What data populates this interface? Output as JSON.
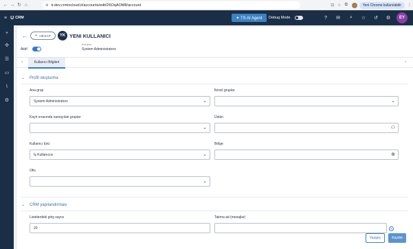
{
  "browser": {
    "url": "tr.dev.crmincloud.it/accounts/edit/26OqAOM8/account",
    "profile_label": "Yeni Chrome kullanılabilir"
  },
  "header": {
    "brand": "CRM",
    "brand_mark": "U",
    "agent_button": "✦ TS AI Agent",
    "debug_label": "Debug Mode",
    "user_initials": "EY"
  },
  "page": {
    "entity_button": "HESAP",
    "avatar_initials": "YK",
    "title": "YENI KULLANICI",
    "active_label": "Aktif",
    "ana_grup_small": "Ana grup",
    "ana_grup_value": "System Administrators"
  },
  "tabs": [
    {
      "label": "Kullanıcı Bilgileri"
    }
  ],
  "sections": {
    "profile": {
      "title": "Profil oluşturma",
      "fields": {
        "ana_grup": {
          "label": "Ana grup",
          "value": "System Administrators"
        },
        "ikincil_gruplar": {
          "label": "İkincil gruplar",
          "value": ""
        },
        "kayit_gruplar": {
          "label": "Kayıt sırasında varsayılan gruplar",
          "value": ""
        },
        "ustun": {
          "label": "Üstün",
          "value": ""
        },
        "kullanici_turu": {
          "label": "Kullanıcı türü",
          "value": "İş Kullanıcısı"
        },
        "bolge": {
          "label": "Bölge",
          "value": ""
        },
        "ofis": {
          "label": "Ofis",
          "value": ""
        }
      }
    },
    "crm": {
      "title": "CRM yapılandırması",
      "fields": {
        "listeler": {
          "label": "Listelerdeki giriş sayısı",
          "value": "20"
        },
        "takma_ad": {
          "label": "Takma ad (mesajlar)",
          "value": ""
        }
      }
    }
  },
  "footer": {
    "cancel": "Vazgeç",
    "save": "Kaydet"
  },
  "colors": {
    "nav_dark": "#1a2f45",
    "accent": "#2f7bd1",
    "agent": "#3b82c4",
    "section_title": "#3a6ea5"
  }
}
